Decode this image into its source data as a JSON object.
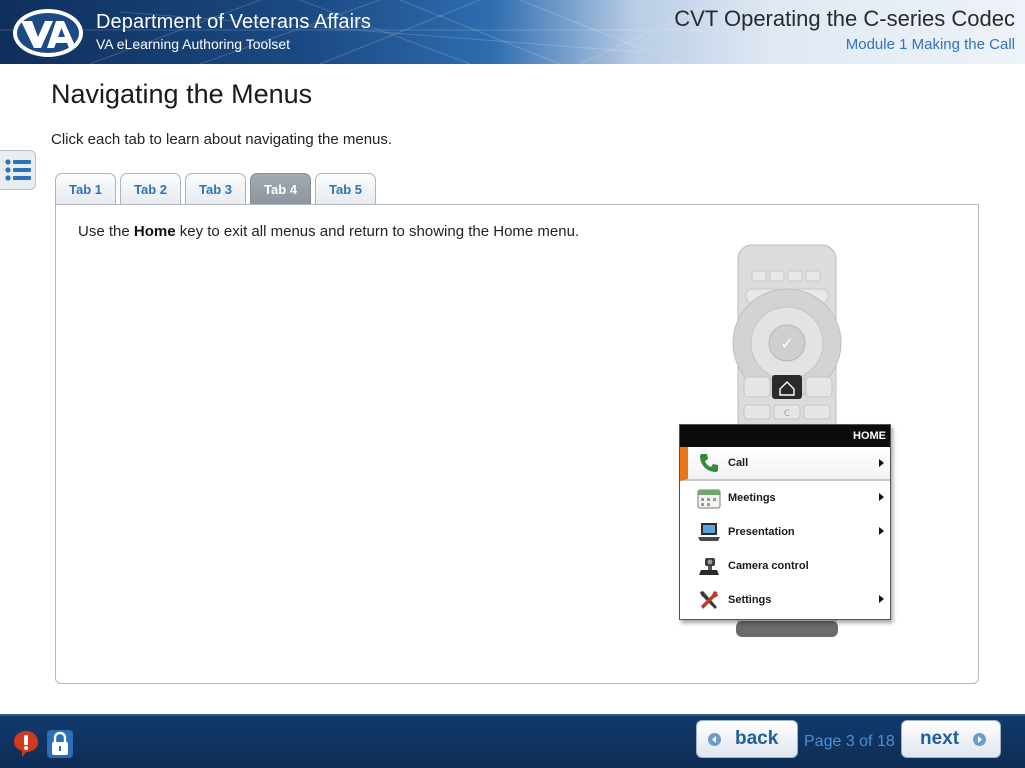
{
  "header": {
    "org_title": "Department of Veterans Affairs",
    "org_subtitle": "VA eLearning Authoring Toolset",
    "logo_text": "VA",
    "course_title": "CVT Operating the C-series Codec",
    "module_title": "Module 1 Making the Call"
  },
  "content": {
    "page_title": "Navigating the Menus",
    "instructions": "Click each tab to learn about navigating the menus.",
    "tabs": [
      {
        "label": "Tab 1",
        "active": false
      },
      {
        "label": "Tab 2",
        "active": false
      },
      {
        "label": "Tab 3",
        "active": false
      },
      {
        "label": "Tab 4",
        "active": true
      },
      {
        "label": "Tab 5",
        "active": false
      }
    ],
    "panel_text_before": "Use the ",
    "panel_text_bold": "Home",
    "panel_text_after": " key to exit all menus and return to showing the Home menu.",
    "remote_keys": {
      "center": "✓",
      "clear": "C"
    },
    "home_menu": {
      "header": "HOME",
      "items": [
        {
          "label": "Call",
          "icon": "phone-icon",
          "selected": true,
          "has_arrow": true
        },
        {
          "label": "Meetings",
          "icon": "calendar-icon",
          "selected": false,
          "has_arrow": true
        },
        {
          "label": "Presentation",
          "icon": "laptop-icon",
          "selected": false,
          "has_arrow": true
        },
        {
          "label": "Camera control",
          "icon": "camera-icon",
          "selected": false,
          "has_arrow": false
        },
        {
          "label": "Settings",
          "icon": "tools-icon",
          "selected": false,
          "has_arrow": true
        }
      ]
    }
  },
  "footer": {
    "back_label": "back",
    "next_label": "next",
    "page_indicator": "Page 3 of 18",
    "icons": [
      "alert-icon",
      "lock-icon"
    ]
  },
  "colors": {
    "accent_blue": "#2e72b8",
    "active_tab": "#8d959e",
    "footer_bg": "#0d2d55",
    "menu_selected": "#e8751a"
  }
}
